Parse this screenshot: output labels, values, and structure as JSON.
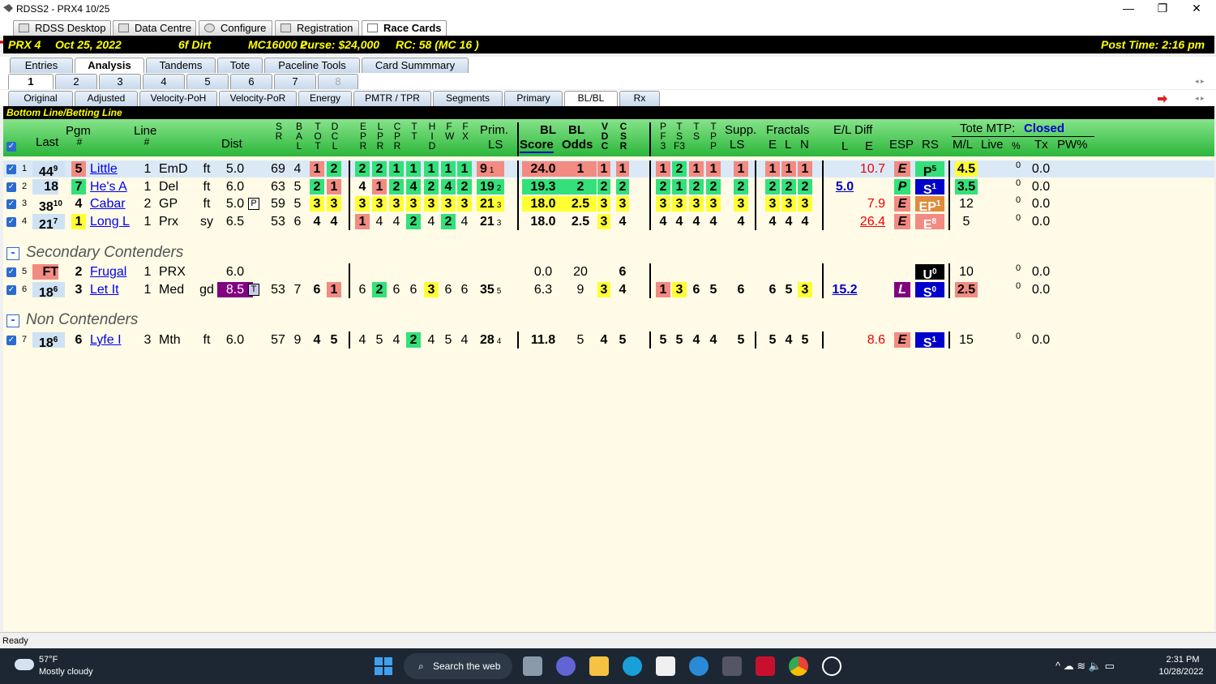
{
  "window": {
    "title": "RDSS2 - PRX4  10/25",
    "min": "—",
    "max": "❐",
    "close": "✕"
  },
  "main_tabs": [
    "RDSS Desktop",
    "Data Centre",
    "Configure",
    "Registration",
    "Race Cards"
  ],
  "race": {
    "track": "PRX  4",
    "date": "Oct 25, 2022",
    "distance": "6f  Dirt",
    "class": "MC16000  2",
    "purse": "Purse: $24,000",
    "rc": "RC: 58  (MC 16 )",
    "post": "Post Time: 2:16 pm"
  },
  "sub_tabs": [
    "Entries",
    "Analysis",
    "Tandems",
    "Tote",
    "Paceline Tools",
    "Card Summmary"
  ],
  "race_tabs": [
    "1",
    "2",
    "3",
    "4",
    "5",
    "6",
    "7",
    "8"
  ],
  "view_tabs": [
    "Original",
    "Adjusted",
    "Velocity-PoH",
    "Velocity-PoR",
    "Energy",
    "PMTR / TPR",
    "Segments",
    "Primary",
    "BL/BL",
    "Rx"
  ],
  "bl_title": "Bottom Line/Betting Line",
  "header": {
    "last": "Last",
    "pgm": "Pgm",
    "pgm_hash": "#",
    "line": "Line",
    "line_hash": "#",
    "dist": "Dist",
    "sr": [
      "S",
      "R"
    ],
    "bal": [
      "B",
      "A",
      "L"
    ],
    "tot": [
      "T",
      "O",
      "T"
    ],
    "dcl": [
      "D",
      "C",
      "L"
    ],
    "epr": [
      "E",
      "P",
      "R"
    ],
    "lpr": [
      "L",
      "P",
      "R"
    ],
    "cpr": [
      "C",
      "P",
      "R"
    ],
    "tt": [
      "T",
      "T"
    ],
    "hid": [
      "H",
      "I",
      "D"
    ],
    "fw": [
      "F",
      "W"
    ],
    "fx": [
      "F",
      "X"
    ],
    "prim": "Prim.",
    "ls": "LS",
    "bl": "BL",
    "score": "Score",
    "bl2": "BL",
    "odds": "Odds",
    "vdc": [
      "V",
      "D",
      "C"
    ],
    "csr": [
      "C",
      "S",
      "R"
    ],
    "pf3": [
      "P",
      "F",
      "3"
    ],
    "ts": [
      "T",
      "S",
      "F3"
    ],
    "ts2": [
      "T",
      "S"
    ],
    "tp": [
      "T",
      "P"
    ],
    "supp": "Supp.",
    "supp_ls": "LS",
    "fractals": "Fractals",
    "fe": "E",
    "fl": "L",
    "fn": "N",
    "eldiff": "E/L Diff",
    "eld_l": "L",
    "eld_e": "E",
    "esp": "ESP",
    "rs": "RS",
    "tote": "Tote MTP:",
    "closed": "Closed",
    "ml": "M/L",
    "live": "Live",
    "pct": "%",
    "tx": "Tx",
    "pw": "PW%"
  },
  "rows": [
    {
      "n": "1",
      "last": "44",
      "last_s": "9",
      "pgm": "5",
      "name": "Little",
      "line": "1",
      "trk": "EmD",
      "cond": "ft",
      "dist": "5.0",
      "sr": "69",
      "bal": "4",
      "tot": "1",
      "dcl": "2",
      "f": [
        "2",
        "2",
        "1",
        "1",
        "1",
        "1",
        "1"
      ],
      "prim": "9",
      "prim_s": "1",
      "score": "24.0",
      "odds": "1",
      "vdc": "1",
      "csr": "1",
      "p": [
        "1",
        "2",
        "1",
        "1"
      ],
      "supp": "1",
      "fr": [
        "1",
        "1",
        "1"
      ],
      "ldiff": "",
      "ediff": "10.7",
      "esp": "E",
      "rs": "P",
      "rs_s": "5",
      "ml": "4.5",
      "pct": "0",
      "tx": "0.0"
    },
    {
      "n": "2",
      "last": "18",
      "last_s": "",
      "pgm": "7",
      "name": "He's A",
      "line": "1",
      "trk": "Del",
      "cond": "ft",
      "dist": "6.0",
      "sr": "63",
      "bal": "5",
      "tot": "2",
      "dcl": "1",
      "f": [
        "4",
        "1",
        "2",
        "4",
        "2",
        "4",
        "2"
      ],
      "prim": "19",
      "prim_s": "2",
      "score": "19.3",
      "odds": "2",
      "vdc": "2",
      "csr": "2",
      "p": [
        "2",
        "1",
        "2",
        "2"
      ],
      "supp": "2",
      "fr": [
        "2",
        "2",
        "2"
      ],
      "ldiff": "5.0",
      "ediff": "",
      "esp": "P",
      "rs": "S",
      "rs_s": "1",
      "ml": "3.5",
      "pct": "0",
      "tx": "0.0"
    },
    {
      "n": "3",
      "last": "38",
      "last_s": "10",
      "pgm": "4",
      "name": "Cabar",
      "line": "2",
      "trk": "GP",
      "cond": "ft",
      "dist": "5.0",
      "distm": "P",
      "sr": "59",
      "bal": "5",
      "tot": "3",
      "dcl": "3",
      "f": [
        "3",
        "3",
        "3",
        "3",
        "3",
        "3",
        "3"
      ],
      "prim": "21",
      "prim_s": "3",
      "score": "18.0",
      "odds": "2.5",
      "vdc": "3",
      "csr": "3",
      "p": [
        "3",
        "3",
        "3",
        "3"
      ],
      "supp": "3",
      "fr": [
        "3",
        "3",
        "3"
      ],
      "ldiff": "",
      "ediff": "7.9",
      "esp": "E",
      "rs": "EP",
      "rs_s": "1",
      "ml": "12",
      "pct": "0",
      "tx": "0.0"
    },
    {
      "n": "4",
      "last": "21",
      "last_s": "7",
      "pgm": "1",
      "name": "Long L",
      "line": "1",
      "trk": "Prx",
      "cond": "sy",
      "dist": "6.5",
      "sr": "53",
      "bal": "6",
      "tot": "4",
      "dcl": "4",
      "f": [
        "1",
        "4",
        "4",
        "2",
        "4",
        "2",
        "4"
      ],
      "prim": "21",
      "prim_s": "3",
      "score": "18.0",
      "odds": "2.5",
      "vdc": "3",
      "csr": "4",
      "p": [
        "4",
        "4",
        "4",
        "4"
      ],
      "supp": "4",
      "fr": [
        "4",
        "4",
        "4"
      ],
      "ldiff": "",
      "ediff": "26.4",
      "esp": "E",
      "rs": "E",
      "rs_s": "8",
      "ml": "5",
      "pct": "0",
      "tx": "0.0"
    },
    {
      "n": "5",
      "last": "FT",
      "last_s": "",
      "pgm": "2",
      "name": "Frugal",
      "line": "1",
      "trk": "PRX",
      "cond": "",
      "dist": "6.0",
      "sr": "",
      "bal": "",
      "tot": "",
      "dcl": "",
      "f": [
        "",
        "",
        "",
        "",
        "",
        "",
        ""
      ],
      "prim": "",
      "prim_s": "",
      "score": "0.0",
      "odds": "20",
      "vdc": "",
      "csr": "6",
      "p": [
        "",
        "",
        "",
        ""
      ],
      "supp": "",
      "fr": [
        "",
        "",
        ""
      ],
      "ldiff": "",
      "ediff": "",
      "esp": "",
      "rs": "U",
      "rs_s": "0",
      "ml": "10",
      "pct": "0",
      "tx": "0.0"
    },
    {
      "n": "6",
      "last": "18",
      "last_s": "6",
      "pgm": "3",
      "name": "Let It",
      "line": "1",
      "trk": "Med",
      "cond": "gd",
      "dist": "8.5",
      "distm": "T",
      "sr": "53",
      "bal": "7",
      "tot": "6",
      "dcl": "1",
      "f": [
        "6",
        "2",
        "6",
        "6",
        "3",
        "6",
        "6"
      ],
      "prim": "35",
      "prim_s": "5",
      "score": "6.3",
      "odds": "9",
      "vdc": "3",
      "csr": "4",
      "p": [
        "1",
        "3",
        "6",
        "5"
      ],
      "supp": "6",
      "fr": [
        "6",
        "5",
        "3"
      ],
      "ldiff": "15.2",
      "ediff": "",
      "esp": "L",
      "rs": "S",
      "rs_s": "0",
      "ml": "2.5",
      "pct": "0",
      "tx": "0.0"
    },
    {
      "n": "7",
      "last": "18",
      "last_s": "6",
      "pgm": "6",
      "name": "Lyfe I",
      "line": "3",
      "trk": "Mth",
      "cond": "ft",
      "dist": "6.0",
      "sr": "57",
      "bal": "9",
      "tot": "4",
      "dcl": "5",
      "f": [
        "4",
        "5",
        "4",
        "2",
        "4",
        "5",
        "4"
      ],
      "prim": "28",
      "prim_s": "4",
      "score": "11.8",
      "odds": "5",
      "vdc": "4",
      "csr": "5",
      "p": [
        "5",
        "5",
        "4",
        "4"
      ],
      "supp": "5",
      "fr": [
        "5",
        "4",
        "5"
      ],
      "ldiff": "",
      "ediff": "8.6",
      "esp": "E",
      "rs": "S",
      "rs_s": "1",
      "ml": "15",
      "pct": "0",
      "tx": "0.0"
    }
  ],
  "sections": {
    "secondary": "Secondary Contenders",
    "non": "Non Contenders",
    "minus": "-"
  },
  "status": "Ready",
  "taskbar": {
    "temp": "57°F",
    "weather": "Mostly cloudy",
    "search": "Search the web",
    "time": "2:31 PM",
    "date": "10/28/2022"
  },
  "colors": {
    "red": "#f28b82",
    "green": "#33e07a",
    "yellow": "#ffff33",
    "navy": "#0000cc",
    "purple": "#800080",
    "orange": "#e08a3a",
    "black": "#000000",
    "blue": "#cfe2f3"
  }
}
